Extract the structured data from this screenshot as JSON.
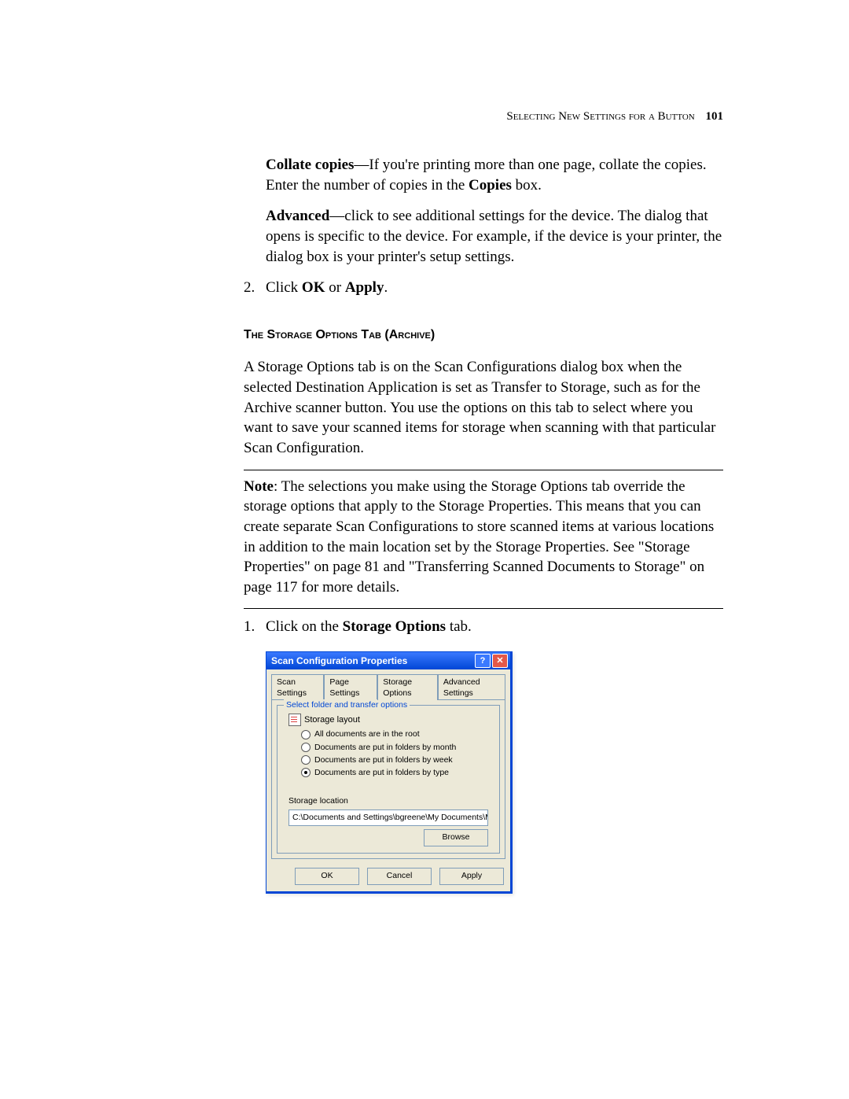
{
  "header": {
    "running_head": "Selecting New Settings for a Button",
    "page_number": "101"
  },
  "paragraphs": {
    "collate_label": "Collate copies",
    "collate_text": "—If you're printing more than one page, collate the copies. Enter the number of copies in the ",
    "collate_bold2": "Copies",
    "collate_tail": " box.",
    "advanced_label": "Advanced",
    "advanced_text": "—click to see additional settings for the device. The dialog that opens is specific to the device. For example, if the device is your printer, the dialog box is your printer's setup settings.",
    "step2_num": "2.",
    "step2_a": "Click ",
    "step2_b": "OK",
    "step2_c": " or ",
    "step2_d": "Apply",
    "step2_e": ".",
    "section_title": "The Storage Options Tab (Archive)",
    "intro": "A Storage Options tab is on the Scan Configurations dialog box when the selected Destination Application is set as Transfer to Storage, such as for the Archive scanner button. You use the options on this tab to select where you want to save your scanned items for storage when scanning with that particular Scan Configuration.",
    "note_label": "Note",
    "note_text": ":  The selections you make using the Storage Options tab override the storage options that apply to the Storage Properties. This means that you can create separate Scan Configurations to store scanned items at various locations in addition to the main location set by the Storage Properties. See \"Storage Properties\" on page 81 and \"Transferring Scanned Documents to Storage\" on page 117 for more details.",
    "step1_num": "1.",
    "step1_a": "Click on the ",
    "step1_b": "Storage Options",
    "step1_c": " tab."
  },
  "dialog": {
    "title": "Scan Configuration Properties",
    "help": "?",
    "close": "✕",
    "tabs": {
      "scan": "Scan Settings",
      "page": "Page Settings",
      "storage": "Storage Options",
      "advanced": "Advanced Settings"
    },
    "group_title": "Select folder and transfer options",
    "layout_label": "Storage layout",
    "radios": {
      "r1": "All documents are in the root",
      "r2": "Documents are put in folders by month",
      "r3": "Documents are put in folders by week",
      "r4": "Documents are put in folders by type"
    },
    "location_label": "Storage location",
    "location_path": "C:\\Documents and Settings\\bgreene\\My Documents\\My OneTou",
    "browse": "Browse",
    "ok": "OK",
    "cancel": "Cancel",
    "apply": "Apply"
  }
}
